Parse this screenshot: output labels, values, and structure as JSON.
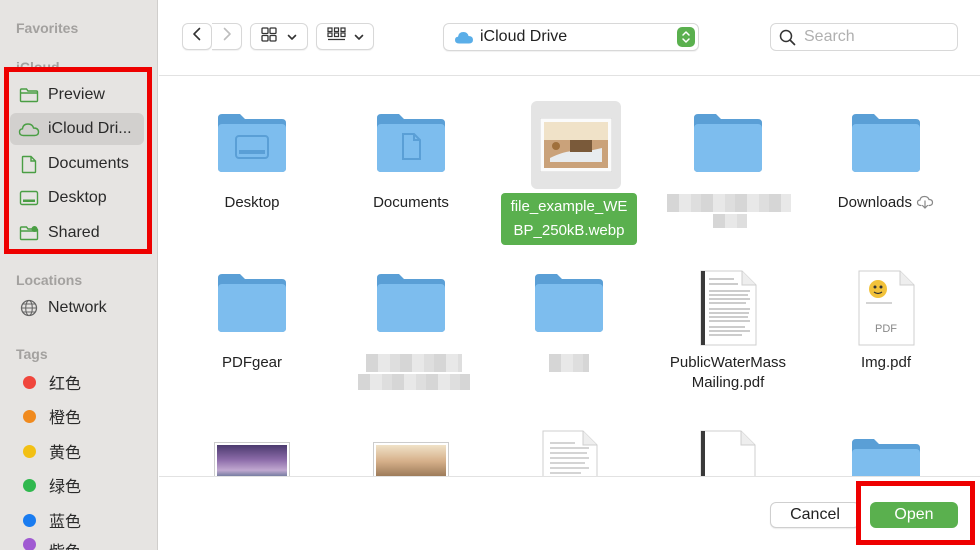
{
  "sidebar": {
    "favorites_heading": "Favorites",
    "icloud_heading": "iCloud",
    "items": [
      {
        "label": "Preview",
        "icon": "folder-icon"
      },
      {
        "label": "iCloud Dri...",
        "icon": "icloud-icon",
        "selected": true
      },
      {
        "label": "Documents",
        "icon": "document-icon"
      },
      {
        "label": "Desktop",
        "icon": "desktop-icon"
      },
      {
        "label": "Shared",
        "icon": "shared-folder-icon"
      }
    ],
    "locations_heading": "Locations",
    "locations": [
      {
        "label": "Network",
        "icon": "globe-icon"
      }
    ],
    "tags_heading": "Tags",
    "tags": [
      {
        "label": "红色",
        "color": "#f0463c"
      },
      {
        "label": "橙色",
        "color": "#f08a1e"
      },
      {
        "label": "黄色",
        "color": "#f2c014"
      },
      {
        "label": "绿色",
        "color": "#30b84e"
      },
      {
        "label": "蓝色",
        "color": "#1a7cf0"
      },
      {
        "label": "紫色",
        "color": "#a05ad2"
      }
    ]
  },
  "toolbar": {
    "location": "iCloud Drive",
    "search_placeholder": "Search"
  },
  "files": [
    {
      "name": "Desktop",
      "kind": "folder"
    },
    {
      "name": "Documents",
      "kind": "folder"
    },
    {
      "name": "file_example_WEBP_250kB.webp",
      "name_line1": "file_example_WE",
      "name_line2": "BP_250kB.webp",
      "kind": "image",
      "selected": true
    },
    {
      "name": "",
      "kind": "folder"
    },
    {
      "name": "Downloads",
      "kind": "folder"
    },
    {
      "name": "PDFgear",
      "kind": "folder"
    },
    {
      "name": "",
      "kind": "folder"
    },
    {
      "name": "",
      "kind": "folder"
    },
    {
      "name": "PublicWaterMassMailing.pdf",
      "name_line1": "PublicWaterMass",
      "name_line2": "Mailing.pdf",
      "kind": "pdf"
    },
    {
      "name": "Img.pdf",
      "kind": "pdf",
      "badge": "PDF"
    }
  ],
  "buttons": {
    "cancel": "Cancel",
    "open": "Open"
  },
  "colors": {
    "accent": "#5ab04e",
    "folder": "#6fb3e8",
    "highlight": "#ee0000"
  }
}
